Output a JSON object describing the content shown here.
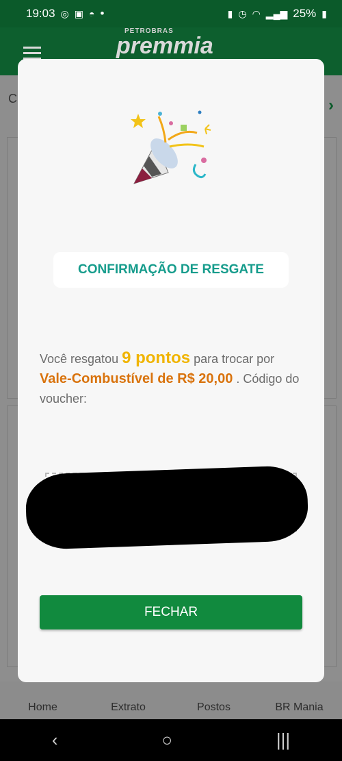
{
  "status_bar": {
    "time": "19:03",
    "dot": "•",
    "battery": "25%"
  },
  "app_header": {
    "brand_small": "PETROBRAS",
    "brand": "premmia"
  },
  "background": {
    "partial_letter": "C"
  },
  "bottom_nav": {
    "items": [
      "Home",
      "Extrato",
      "Postos",
      "BR Mania"
    ]
  },
  "modal": {
    "title": "CONFIRMAÇÃO DE RESGATE",
    "message_prefix": "Você resgatou ",
    "points": "9 pontos",
    "message_mid": " para trocar por ",
    "product": "Vale-Combustível de R$ 20,00",
    "message_suffix": " . Código do voucher:",
    "button_label": "FECHAR"
  },
  "colors": {
    "brand_green": "#118a3e",
    "title_teal": "#169c8c",
    "points_yellow": "#f0b400",
    "product_orange": "#d9730d"
  },
  "icons": [
    "whatsapp-icon",
    "gallery-icon",
    "incognito-icon",
    "alarm-icon",
    "wifi-icon",
    "signal-icon",
    "battery-icon",
    "confetti-icon"
  ]
}
